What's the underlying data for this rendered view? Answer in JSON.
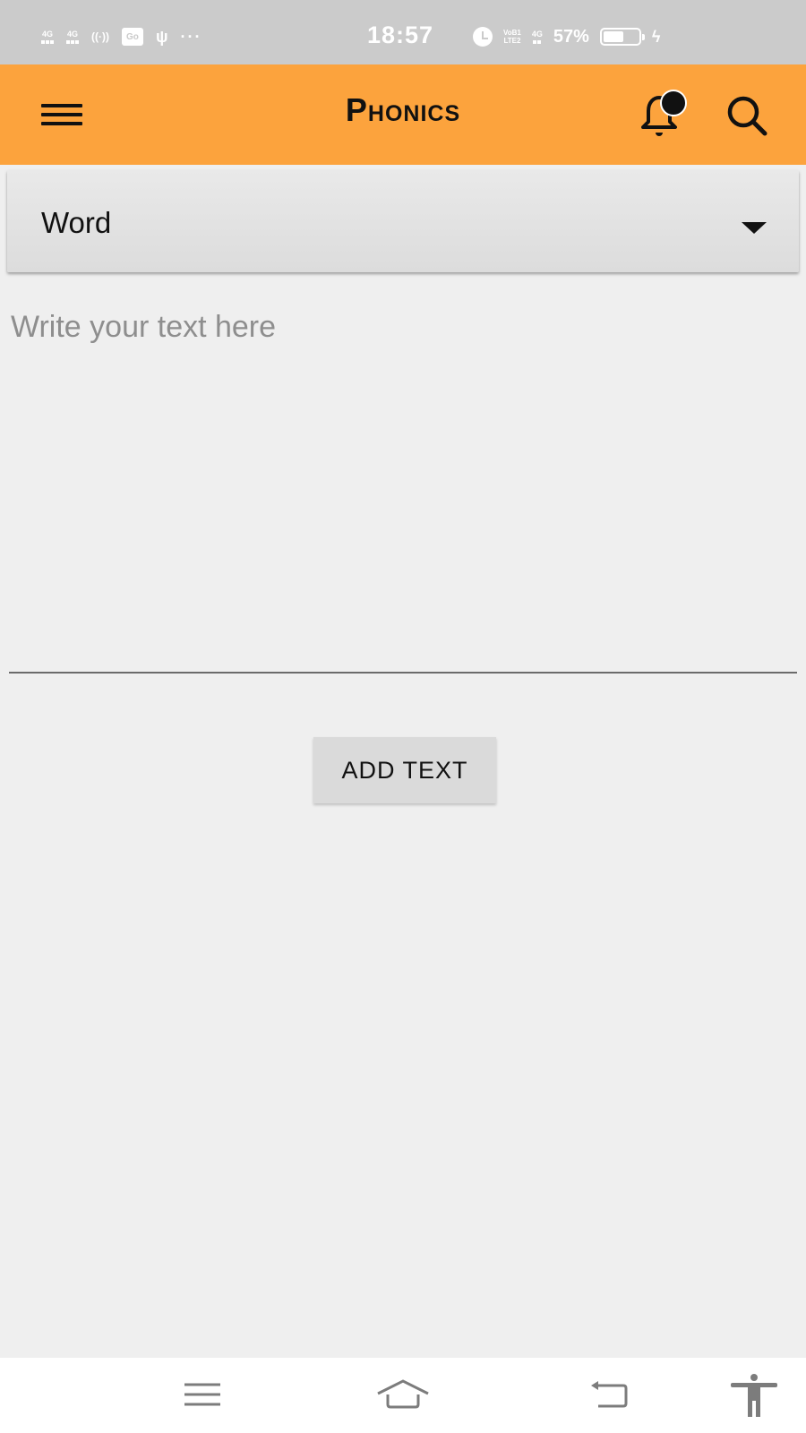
{
  "status_bar": {
    "signal_1": "4G",
    "signal_2": "4G",
    "hotspot": "((·))",
    "box_icon_text": "Go",
    "usb_icon": "usb-icon",
    "more": "···",
    "time": "18:57",
    "volte_line1": "VoB1",
    "volte_line2": "LTE2",
    "data_type": "4G",
    "battery_percent_text": "57%",
    "battery_level": 0.57,
    "charging": "ϟ"
  },
  "app_bar": {
    "title": "Phonics",
    "menu_icon": "hamburger-icon",
    "notification_icon": "bell-icon",
    "search_icon": "search-icon",
    "accent_color": "#fca33d"
  },
  "spinner": {
    "selected": "Word"
  },
  "text_input": {
    "value": "",
    "placeholder": "Write your text here"
  },
  "add_button": {
    "label": "ADD TEXT"
  },
  "nav_bar": {
    "items": [
      "menu",
      "home",
      "back",
      "accessibility"
    ]
  }
}
